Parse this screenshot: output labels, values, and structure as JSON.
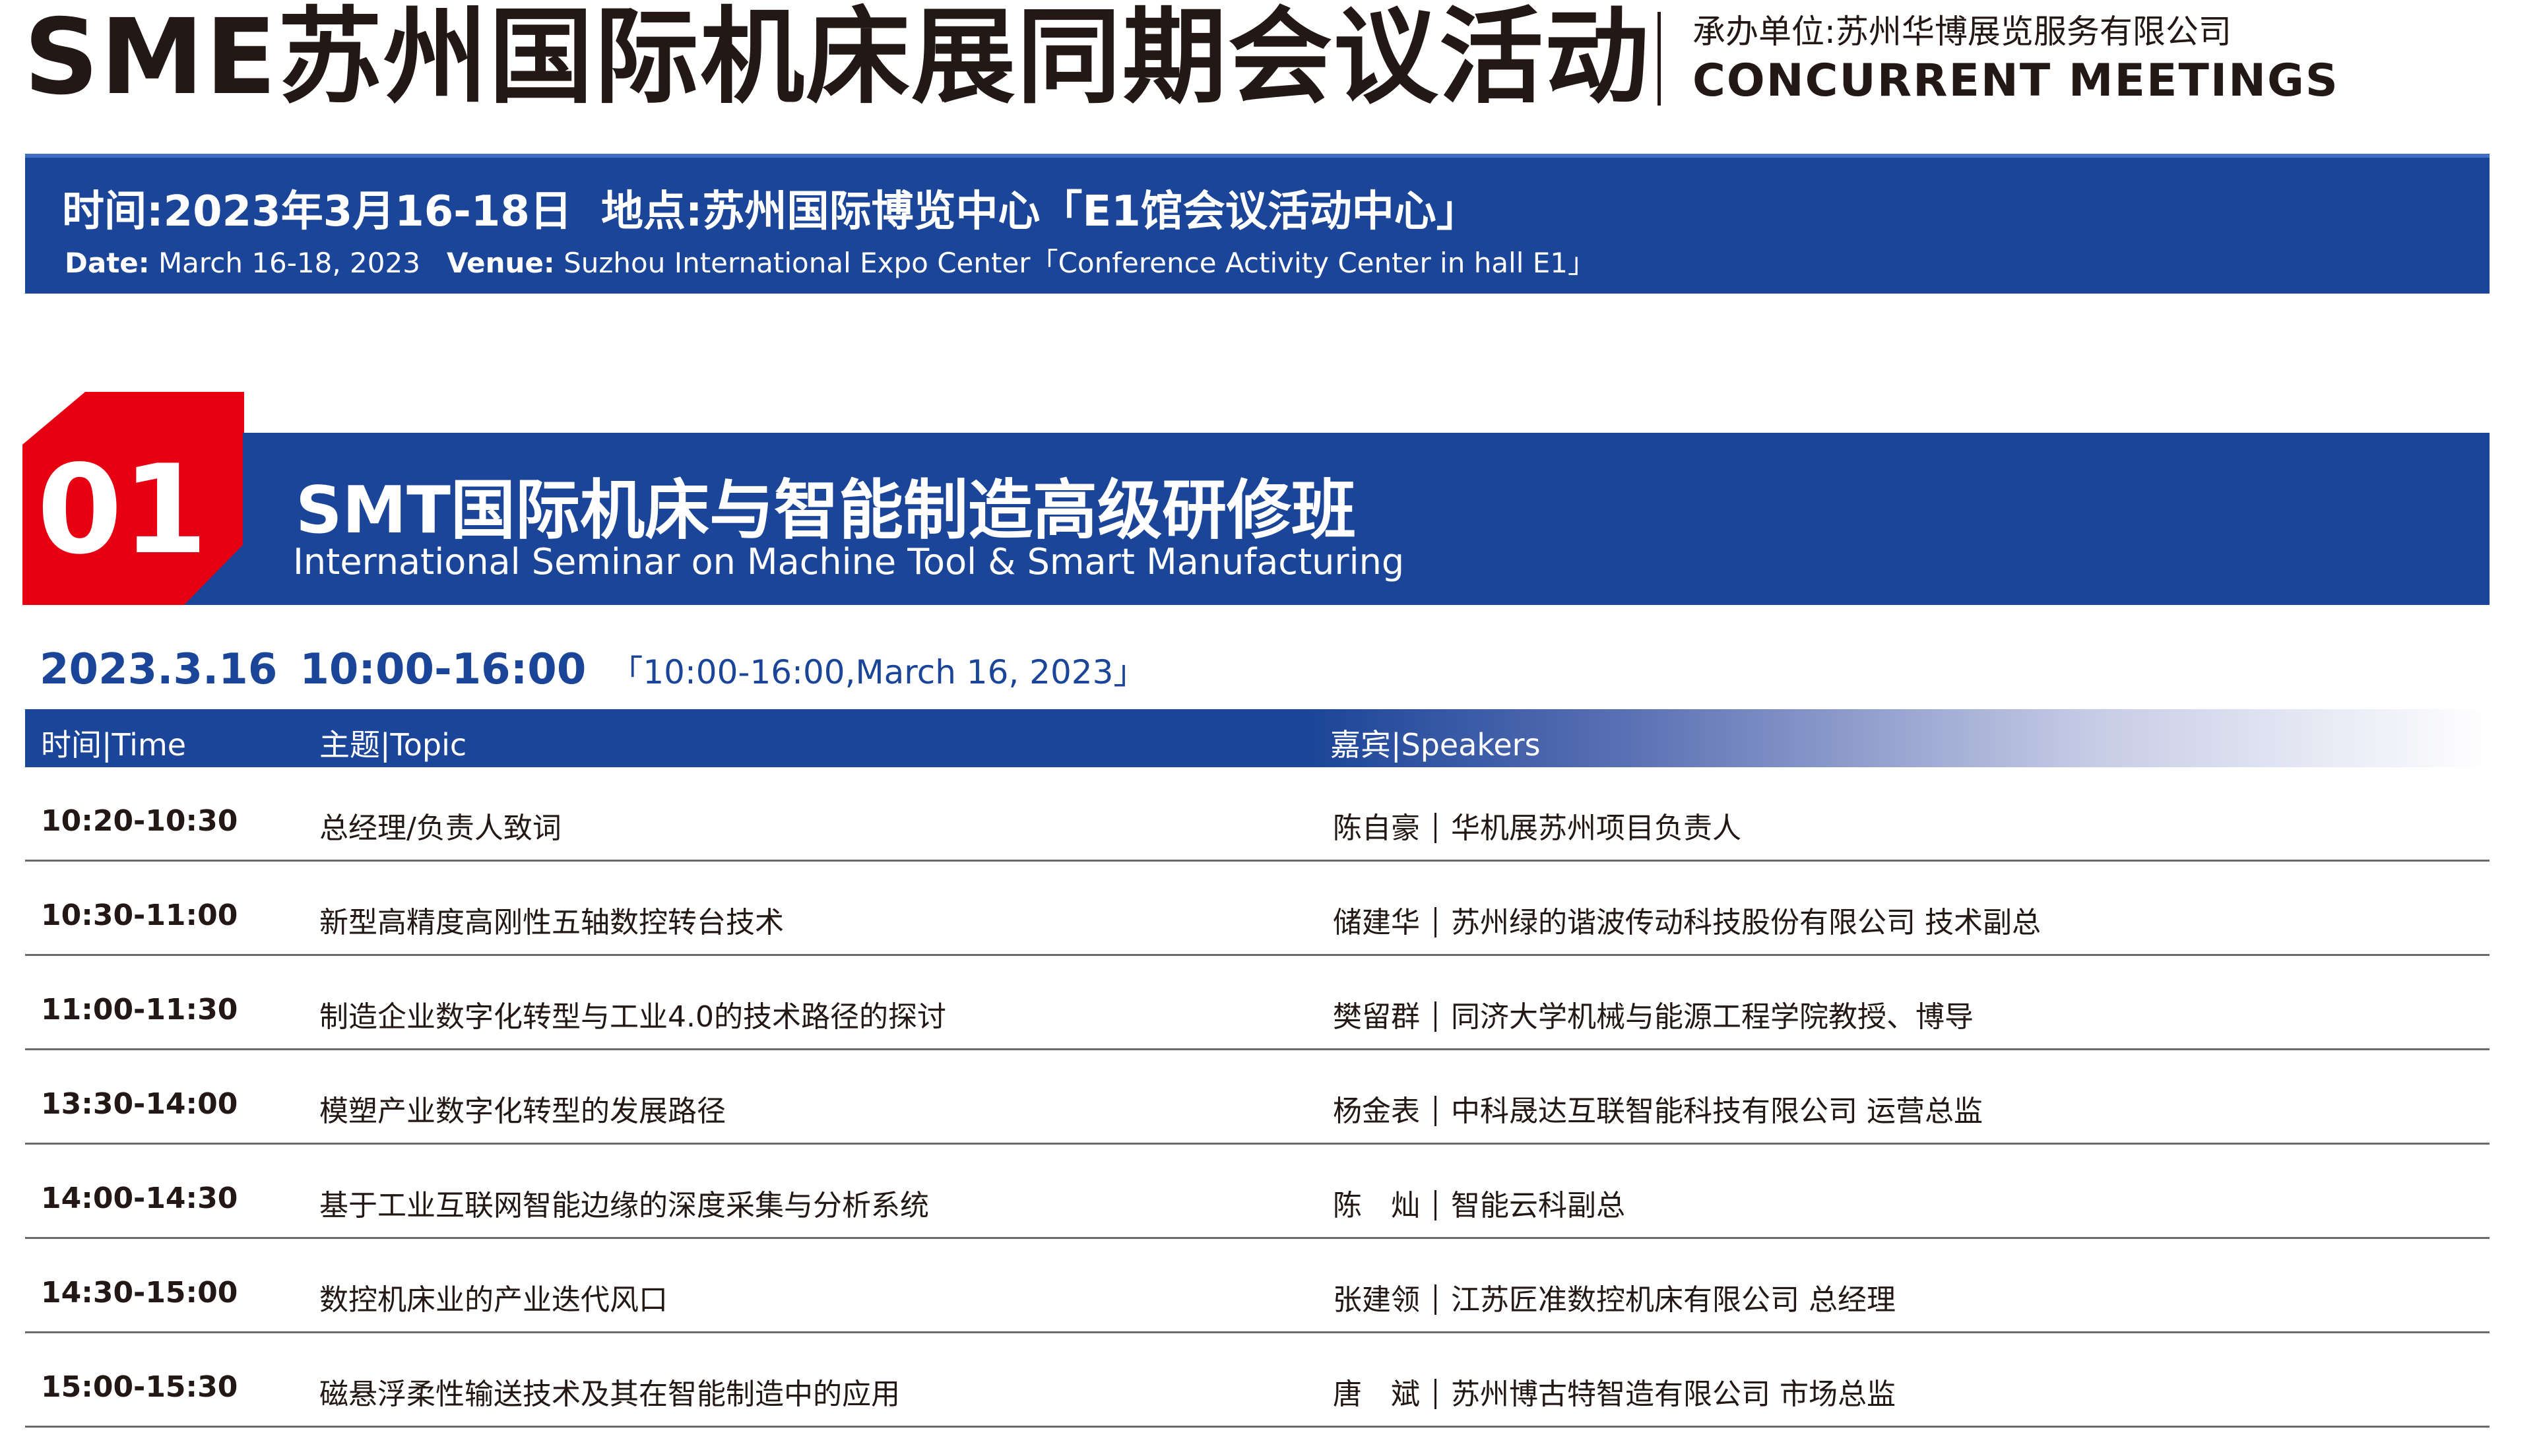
{
  "header": {
    "title": "SME苏州国际机床展同期会议活动",
    "organizer": "承办单位:苏州华博展览服务有限公司",
    "subtitle_en": "CONCURRENT MEETINGS"
  },
  "info": {
    "cn_time": "时间:2023年3月16-18日",
    "cn_venue": "地点:苏州国际博览中心「E1馆会议活动中心」",
    "en_date_label": "Date:",
    "en_date_value": "March 16-18, 2023",
    "en_venue_label": "Venue:",
    "en_venue_value": "Suzhou International Expo Center「Conference Activity Center in hall E1」"
  },
  "section": {
    "number": "01",
    "title_cn": "SMT国际机床与智能制造高级研修班",
    "title_en": "International Seminar on Machine Tool & Smart Manufacturing",
    "date": "2023.3.16",
    "time": "10:00-16:00",
    "date_en": "「10:00-16:00,March 16, 2023」",
    "colors": {
      "brand_blue": "#1b4598",
      "accent_red": "#e60012"
    }
  },
  "table": {
    "headers": {
      "time": "时间|Time",
      "topic": "主题|Topic",
      "speakers": "嘉宾|Speakers"
    },
    "rows": [
      {
        "time": "10:20-10:30",
        "topic": "总经理/负责人致词",
        "speaker": "陈自豪",
        "title": "华机展苏州项目负责人"
      },
      {
        "time": "10:30-11:00",
        "topic": "新型高精度高刚性五轴数控转台技术",
        "speaker": "储建华",
        "title": "苏州绿的谐波传动科技股份有限公司 技术副总"
      },
      {
        "time": "11:00-11:30",
        "topic": "制造企业数字化转型与工业4.0的技术路径的探讨",
        "speaker": "樊留群",
        "title": "同济大学机械与能源工程学院教授、博导"
      },
      {
        "time": "13:30-14:00",
        "topic": "模塑产业数字化转型的发展路径",
        "speaker": "杨金表",
        "title": "中科晟达互联智能科技有限公司 运营总监"
      },
      {
        "time": "14:00-14:30",
        "topic": "基于工业互联网智能边缘的深度采集与分析系统",
        "speaker": "陈　灿",
        "title": "智能云科副总"
      },
      {
        "time": "14:30-15:00",
        "topic": "数控机床业的产业迭代风口",
        "speaker": "张建领",
        "title": "江苏匠准数控机床有限公司 总经理"
      },
      {
        "time": "15:00-15:30",
        "topic": "磁悬浮柔性输送技术及其在智能制造中的应用",
        "speaker": "唐　斌",
        "title": "苏州博古特智造有限公司 市场总监"
      }
    ]
  }
}
